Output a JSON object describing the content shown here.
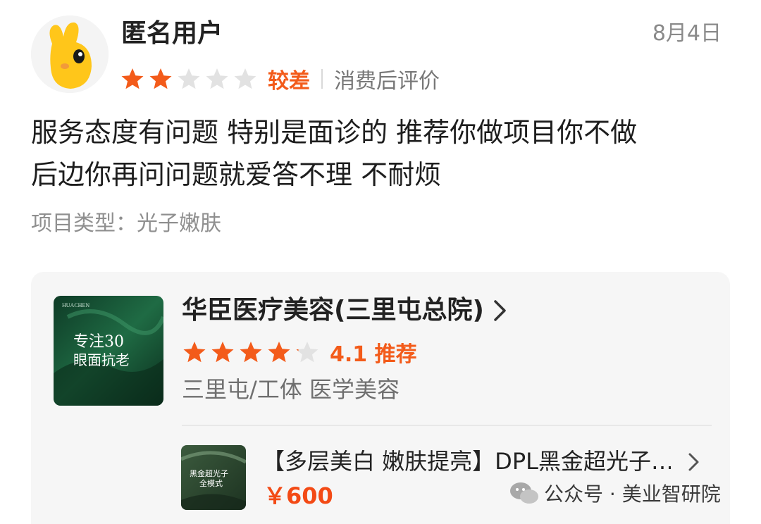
{
  "review": {
    "username": "匿名用户",
    "date": "8月4日",
    "stars": 2,
    "max_stars": 5,
    "rating_word": "较差",
    "rating_note": "消费后评价",
    "comment_lines": [
      "服务态度有问题 特别是面诊的 推荐你做项目你不做",
      "后边你再问问题就爱答不理 不耐烦"
    ],
    "project_label": "项目类型：",
    "project_value": "光子嫩肤"
  },
  "shop": {
    "name": "华臣医疗美容(三里屯总院)",
    "rating": 4.1,
    "score_text": "4.1 推荐",
    "location": "三里屯/工体  医学美容",
    "thumb": {
      "brand": "HUACHEN",
      "headline_1": "专注30",
      "headline_2": "眼面抗老"
    }
  },
  "deal": {
    "title": "【多层美白 嫩肤提亮】DPL黑金超光子…",
    "price": "￥600",
    "thumb_line_1": "黑金超光子",
    "thumb_line_2": "全模式"
  },
  "watermark": {
    "text": "公众号 · 美业智研院"
  },
  "colors": {
    "accent_orange": "#f35b1a",
    "star_empty": "#e2e2e2",
    "card_bg": "#f6f6f6"
  }
}
